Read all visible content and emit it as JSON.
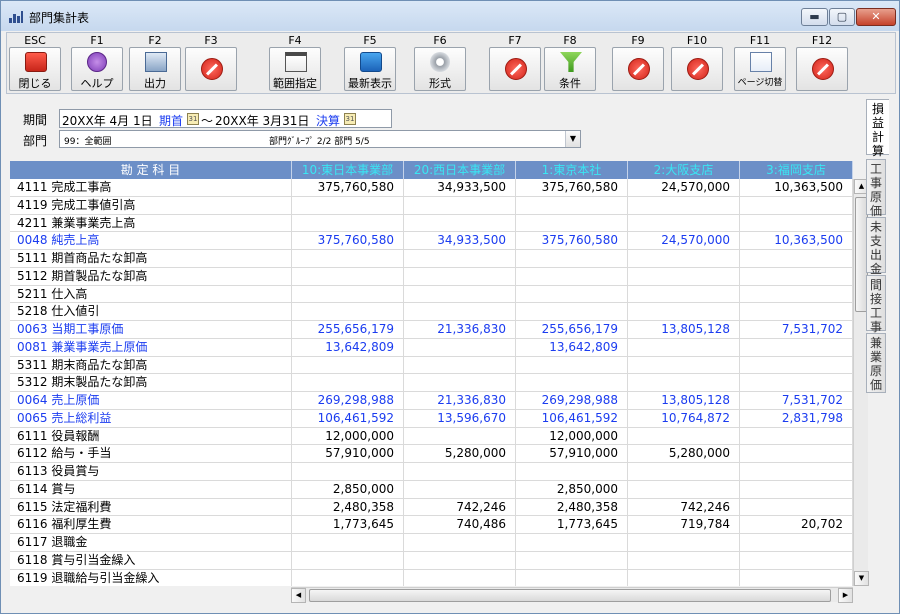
{
  "window": {
    "title": "部門集計表",
    "min_glyph": "▬",
    "max_glyph": "▢",
    "close_glyph": "✕"
  },
  "toolbar": {
    "keys": [
      {
        "key": "ESC",
        "label": "閉じる",
        "icon": "close-icon"
      },
      {
        "key": "F1",
        "label": "ヘルプ",
        "icon": "help-icon"
      },
      {
        "key": "F2",
        "label": "出力",
        "icon": "output-icon"
      },
      {
        "key": "F3",
        "label": "",
        "icon": "disabled-icon"
      },
      {
        "key": "F4",
        "label": "範囲指定",
        "icon": "calendar-range-icon"
      },
      {
        "key": "F5",
        "label": "最新表示",
        "icon": "refresh-icon"
      },
      {
        "key": "F6",
        "label": "形式",
        "icon": "gear-icon"
      },
      {
        "key": "F7",
        "label": "",
        "icon": "disabled-icon"
      },
      {
        "key": "F8",
        "label": "条件",
        "icon": "filter-icon"
      },
      {
        "key": "F9",
        "label": "",
        "icon": "disabled-icon"
      },
      {
        "key": "F10",
        "label": "",
        "icon": "disabled-icon"
      },
      {
        "key": "F11",
        "label": "ページ切替",
        "icon": "page-switch-icon"
      },
      {
        "key": "F12",
        "label": "",
        "icon": "disabled-icon"
      }
    ]
  },
  "filters": {
    "period_label": "期間",
    "start_date": "20XX年 4月 1日",
    "start_kind": "期首",
    "range_sep": "～",
    "end_date": "20XX年 3月31日",
    "end_kind": "決算",
    "dept_label": "部門",
    "dept_value": "99：全範囲",
    "dept_group": "部門ｸﾞﾙｰﾌﾟ 2/2 部門 5/5",
    "calendar_glyph": "31",
    "dropdown_glyph": "▼"
  },
  "grid": {
    "headers": [
      "勘 定 科 目",
      "10:東日本事業部",
      "20:西日本事業部",
      "1:東京本社",
      "2:大阪支店",
      "3:福岡支店"
    ],
    "rows": [
      {
        "account": "4111 完成工事高",
        "values": [
          "375,760,580",
          "34,933,500",
          "375,760,580",
          "24,570,000",
          "10,363,500"
        ],
        "subtotal": false
      },
      {
        "account": "4119 完成工事値引高",
        "values": [
          "",
          "",
          "",
          "",
          ""
        ],
        "subtotal": false
      },
      {
        "account": "4211 兼業事業売上高",
        "values": [
          "",
          "",
          "",
          "",
          ""
        ],
        "subtotal": false
      },
      {
        "account": "0048 純売上高",
        "values": [
          "375,760,580",
          "34,933,500",
          "375,760,580",
          "24,570,000",
          "10,363,500"
        ],
        "subtotal": true
      },
      {
        "account": "5111 期首商品たな卸高",
        "values": [
          "",
          "",
          "",
          "",
          ""
        ],
        "subtotal": false
      },
      {
        "account": "5112 期首製品たな卸高",
        "values": [
          "",
          "",
          "",
          "",
          ""
        ],
        "subtotal": false
      },
      {
        "account": "5211 仕入高",
        "values": [
          "",
          "",
          "",
          "",
          ""
        ],
        "subtotal": false
      },
      {
        "account": "5218 仕入値引",
        "values": [
          "",
          "",
          "",
          "",
          ""
        ],
        "subtotal": false
      },
      {
        "account": "0063 当期工事原価",
        "values": [
          "255,656,179",
          "21,336,830",
          "255,656,179",
          "13,805,128",
          "7,531,702"
        ],
        "subtotal": true
      },
      {
        "account": "0081 兼業事業売上原価",
        "values": [
          "13,642,809",
          "",
          "13,642,809",
          "",
          ""
        ],
        "subtotal": true
      },
      {
        "account": "5311 期末商品たな卸高",
        "values": [
          "",
          "",
          "",
          "",
          ""
        ],
        "subtotal": false
      },
      {
        "account": "5312 期末製品たな卸高",
        "values": [
          "",
          "",
          "",
          "",
          ""
        ],
        "subtotal": false
      },
      {
        "account": "0064 売上原価",
        "values": [
          "269,298,988",
          "21,336,830",
          "269,298,988",
          "13,805,128",
          "7,531,702"
        ],
        "subtotal": true
      },
      {
        "account": "0065 売上総利益",
        "values": [
          "106,461,592",
          "13,596,670",
          "106,461,592",
          "10,764,872",
          "2,831,798"
        ],
        "subtotal": true
      },
      {
        "account": "6111 役員報酬",
        "values": [
          "12,000,000",
          "",
          "12,000,000",
          "",
          ""
        ],
        "subtotal": false
      },
      {
        "account": "6112 給与・手当",
        "values": [
          "57,910,000",
          "5,280,000",
          "57,910,000",
          "5,280,000",
          ""
        ],
        "subtotal": false
      },
      {
        "account": "6113 役員賞与",
        "values": [
          "",
          "",
          "",
          "",
          ""
        ],
        "subtotal": false
      },
      {
        "account": "6114 賞与",
        "values": [
          "2,850,000",
          "",
          "2,850,000",
          "",
          ""
        ],
        "subtotal": false
      },
      {
        "account": "6115 法定福利費",
        "values": [
          "2,480,358",
          "742,246",
          "2,480,358",
          "742,246",
          ""
        ],
        "subtotal": false
      },
      {
        "account": "6116 福利厚生費",
        "values": [
          "1,773,645",
          "740,486",
          "1,773,645",
          "719,784",
          "20,702"
        ],
        "subtotal": false
      },
      {
        "account": "6117 退職金",
        "values": [
          "",
          "",
          "",
          "",
          ""
        ],
        "subtotal": false
      },
      {
        "account": "6118 賞与引当金繰入",
        "values": [
          "",
          "",
          "",
          "",
          ""
        ],
        "subtotal": false
      },
      {
        "account": "6119 退職給与引当金繰入",
        "values": [
          "",
          "",
          "",
          "",
          ""
        ],
        "subtotal": false
      }
    ]
  },
  "scroll": {
    "up": "▲",
    "down": "▼",
    "left": "◀",
    "right": "▶"
  },
  "side_tabs": [
    {
      "label": "損益計算",
      "active": true
    },
    {
      "label": "工事原価",
      "active": false
    },
    {
      "label": "未支出金",
      "active": false
    },
    {
      "label": "間接工事",
      "active": false
    },
    {
      "label": "兼業原価",
      "active": false
    }
  ],
  "colors": {
    "header_bg": "#6c8fc7",
    "dept_header_text": "#39e7f4",
    "subtotal_text": "#1b3cf0",
    "accent_red": "#d2241a"
  }
}
